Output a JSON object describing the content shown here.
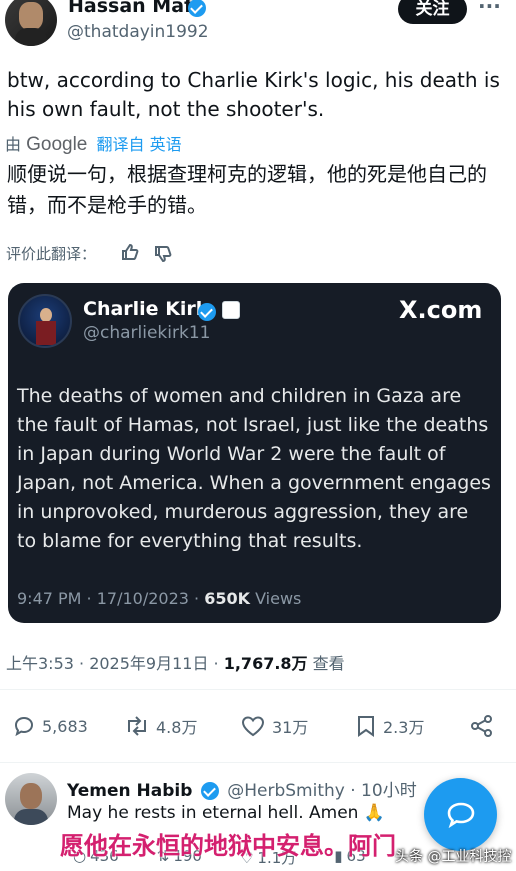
{
  "header": {
    "name": "Hassan Mafi",
    "handle": "@thatdayin1992",
    "follow_label": "关注",
    "more_label": "···"
  },
  "tweet": {
    "text": "btw, according to Charlie Kirk's logic, his death is his own fault, not the shooter's.",
    "translation_prefix": "由",
    "translation_provider": "Google",
    "translation_link": "翻译自 英语",
    "translated_text": "顺便说一句，根据查理柯克的逻辑，他的死是他自己的错，而不是枪手的错。",
    "rate_translation": "评价此翻译："
  },
  "quoted": {
    "name": "Charlie Kirk",
    "handle": "@charliekirk11",
    "brand": "X.com",
    "text": "The deaths of women and children in Gaza are the fault of Hamas, not Israel, just like the deaths in Japan during World War 2 were the fault of Japan, not America. When a government engages in unprovoked, murderous aggression, they are to blame for everything that results.",
    "time": "9:47 PM · 17/10/2023 · ",
    "views_count": "650K",
    "views_label": " Views"
  },
  "meta": {
    "time": "上午3:53 · 2025年9月11日 · ",
    "views_count": "1,767.8万",
    "views_label": " 查看"
  },
  "actions": {
    "replies": "5,683",
    "retweets": "4.8万",
    "likes": "31万",
    "bookmarks": "2.3万"
  },
  "reply": {
    "name": "Yemen Habib",
    "handle": "@HerbSmithy",
    "time": "· 10小时",
    "text": "May he rests in eternal hell. Amen 🙏",
    "replies": "436",
    "retweets": "190",
    "likes": "1.1万",
    "views": "63"
  },
  "overlay": {
    "subtitle": "愿他在永恒的地狱中安息。阿门",
    "watermark": "头条 @工业科技控"
  },
  "colors": {
    "accent": "#1d9bf0",
    "card_bg": "#161c26",
    "subtitle": "#d4206f"
  }
}
